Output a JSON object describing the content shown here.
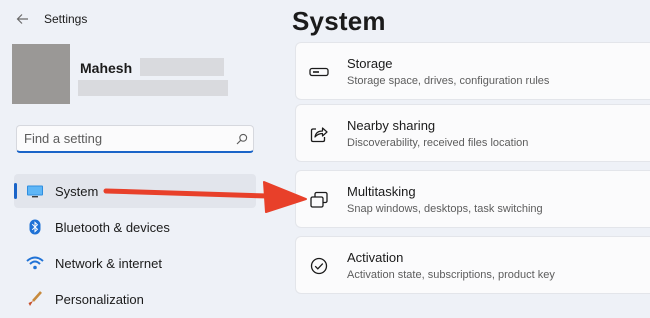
{
  "window": {
    "title": "Settings"
  },
  "user": {
    "name": "Mahesh"
  },
  "search": {
    "placeholder": "Find a setting"
  },
  "sidebar": {
    "items": [
      {
        "label": "System",
        "icon": "monitor-icon",
        "selected": true
      },
      {
        "label": "Bluetooth & devices",
        "icon": "bluetooth-icon"
      },
      {
        "label": "Network & internet",
        "icon": "wifi-icon"
      },
      {
        "label": "Personalization",
        "icon": "brush-icon"
      }
    ]
  },
  "main": {
    "title": "System",
    "cards": [
      {
        "title": "Storage",
        "description": "Storage space, drives, configuration rules",
        "icon": "storage-icon"
      },
      {
        "title": "Nearby sharing",
        "description": "Discoverability, received files location",
        "icon": "share-icon"
      },
      {
        "title": "Multitasking",
        "description": "Snap windows, desktops, task switching",
        "icon": "multitasking-icon"
      },
      {
        "title": "Activation",
        "description": "Activation state, subscriptions, product key",
        "icon": "activation-icon"
      }
    ]
  },
  "colors": {
    "accent": "#1a64c8",
    "arrow": "#e8402a",
    "background": "#eef1f7",
    "card": "#fbfbfc"
  }
}
